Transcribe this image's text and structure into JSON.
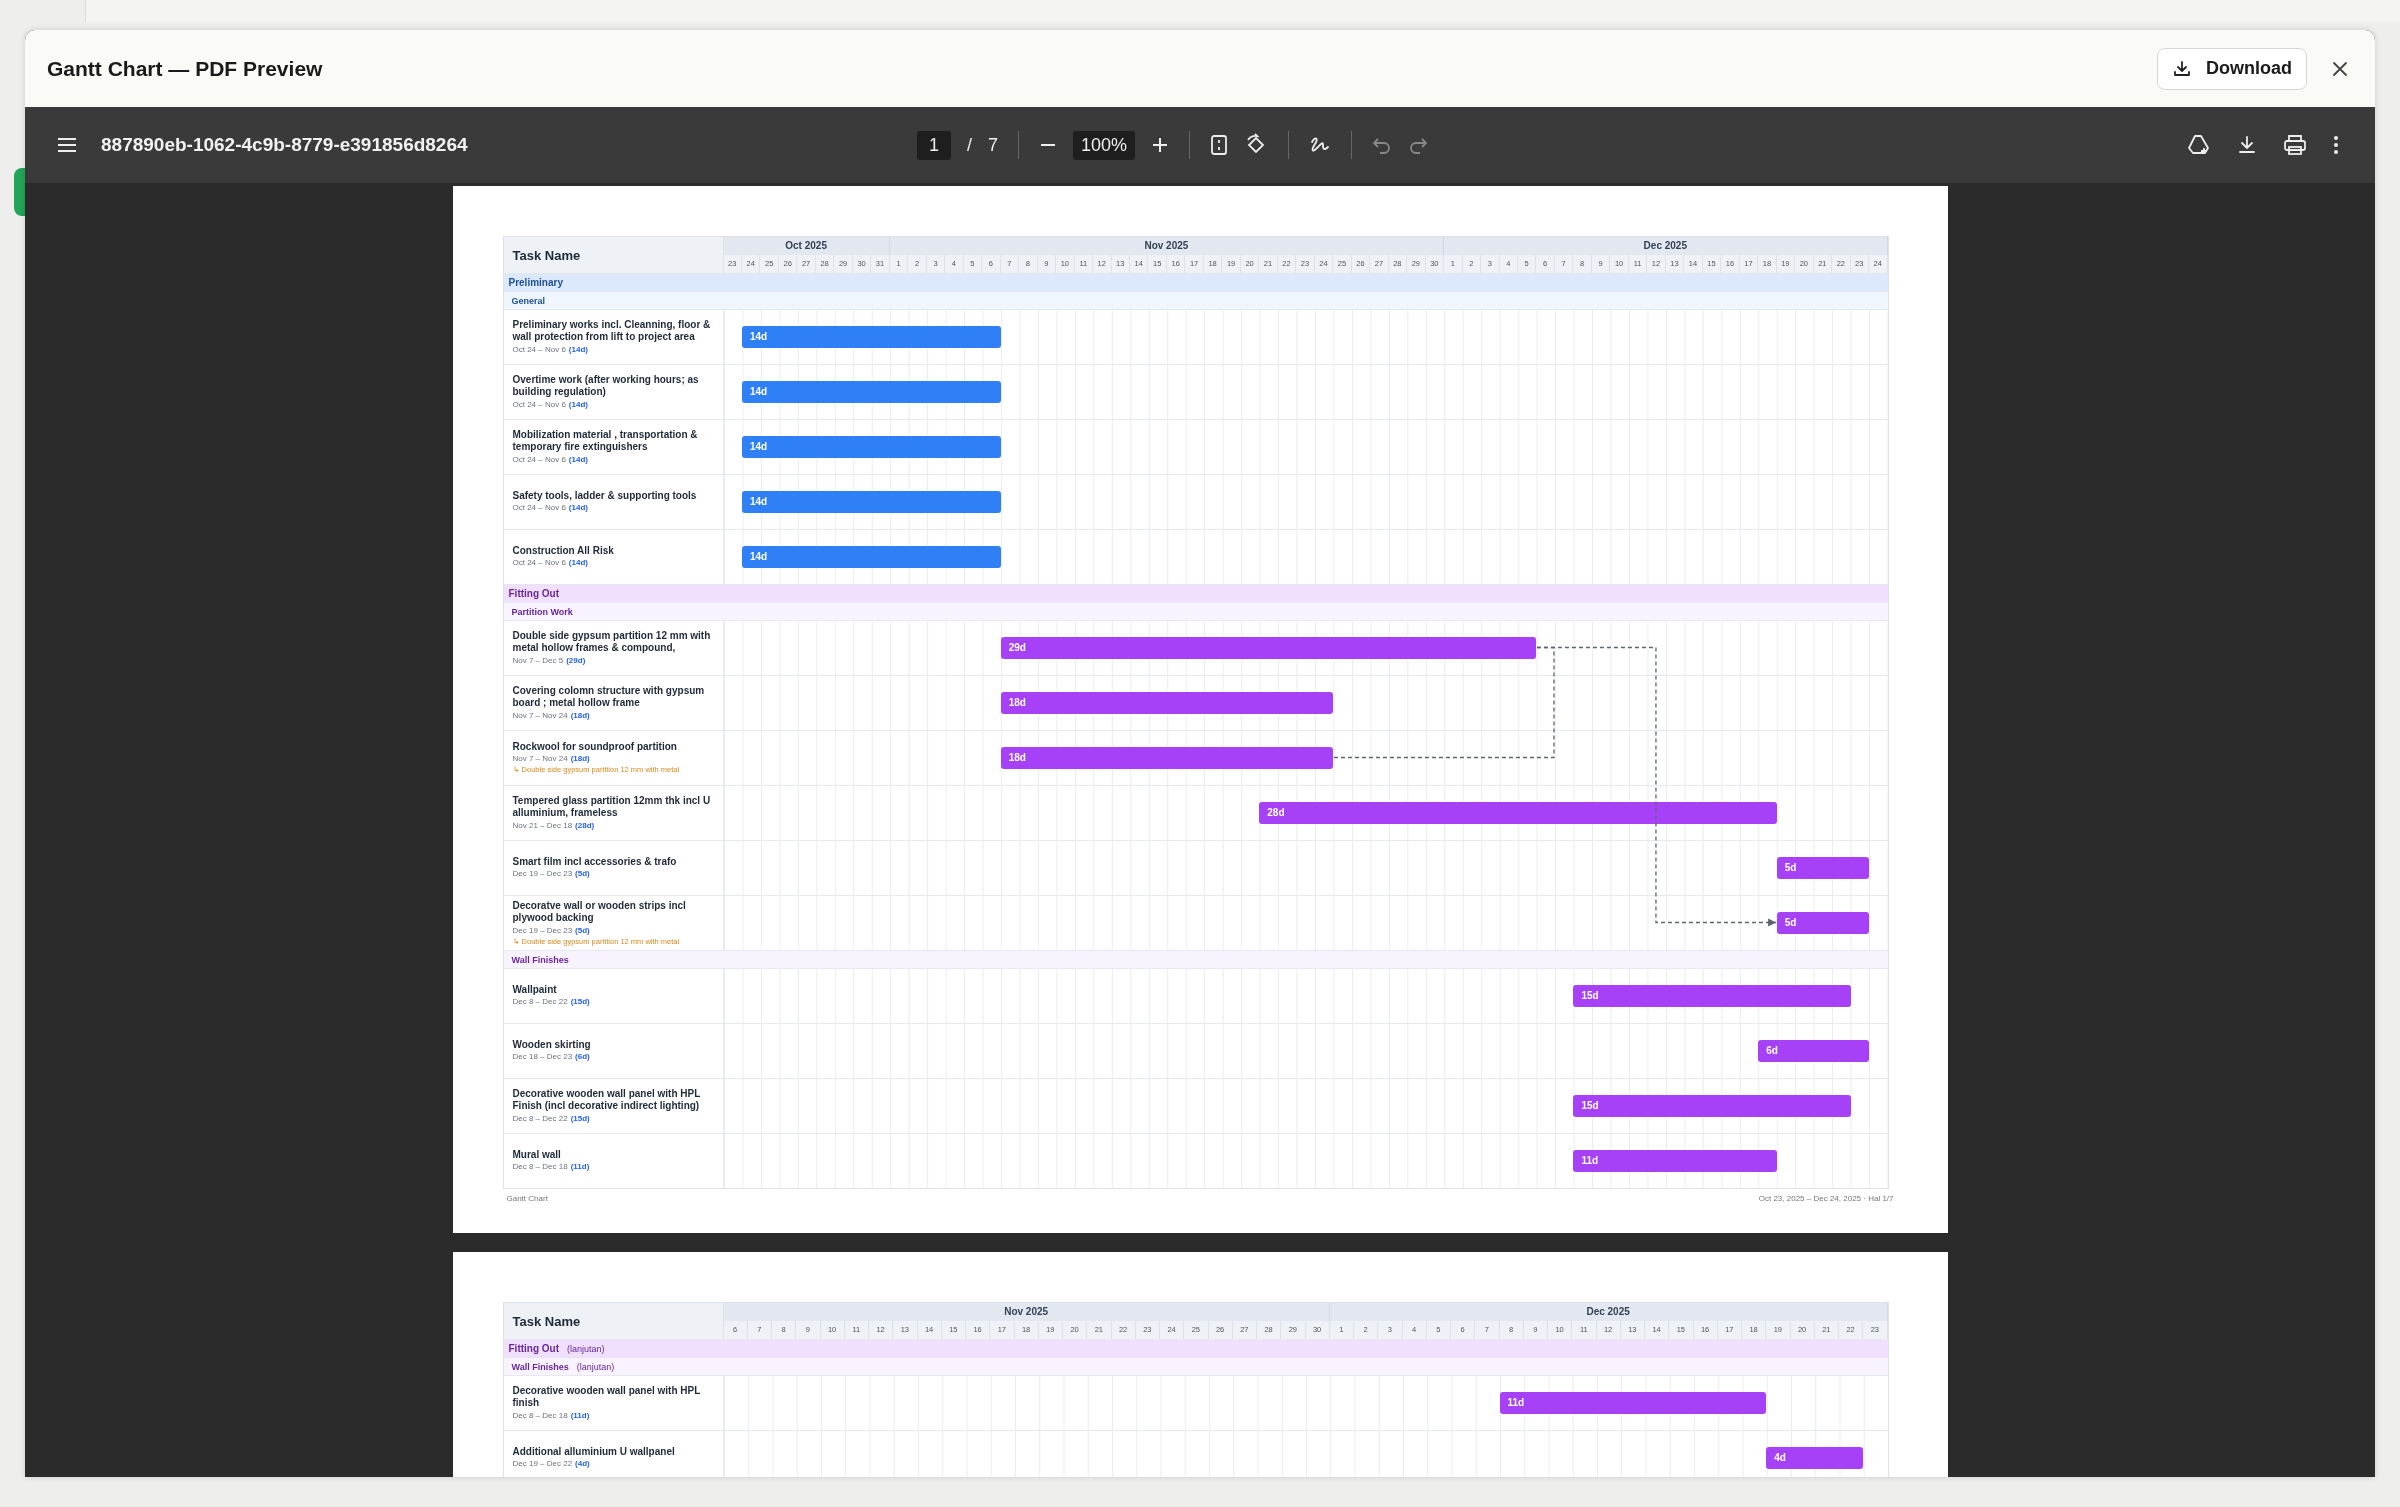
{
  "dialog": {
    "title": "Gantt Chart — PDF Preview",
    "download_label": "Download"
  },
  "viewer": {
    "file_name": "887890eb-1062-4c9b-8779-e391856d8264",
    "page_current": "1",
    "page_separator": "/",
    "page_total": "7",
    "zoom": "100%"
  },
  "pages": [
    {
      "task_header": "Task Name",
      "months": [
        {
          "label": "Oct 2025",
          "days": [
            "23",
            "24",
            "25",
            "26",
            "27",
            "28",
            "29",
            "30",
            "31"
          ]
        },
        {
          "label": "Nov 2025",
          "days": [
            "1",
            "2",
            "3",
            "4",
            "5",
            "6",
            "7",
            "8",
            "9",
            "10",
            "11",
            "12",
            "13",
            "14",
            "15",
            "16",
            "17",
            "18",
            "19",
            "20",
            "21",
            "22",
            "23",
            "24",
            "25",
            "26",
            "27",
            "28",
            "29",
            "30"
          ]
        },
        {
          "label": "Dec 2025",
          "days": [
            "1",
            "2",
            "3",
            "4",
            "5",
            "6",
            "7",
            "8",
            "9",
            "10",
            "11",
            "12",
            "13",
            "14",
            "15",
            "16",
            "17",
            "18",
            "19",
            "20",
            "21",
            "22",
            "23",
            "24"
          ]
        }
      ],
      "groups": [
        {
          "name": "Preliminary",
          "color": "#2f80f6",
          "subgroups": [
            {
              "name": "General",
              "tasks": [
                {
                  "name": "Preliminary works incl. Cleanning, floor & wall protection from lift to project area",
                  "dates": "Oct 24 – Nov 6",
                  "duration": "(14d)",
                  "bar": {
                    "label": "14d"
                  }
                },
                {
                  "name": "Overtime work (after working hours; as building regulation)",
                  "dates": "Oct 24 – Nov 6",
                  "duration": "(14d)",
                  "bar": {
                    "label": "14d"
                  }
                },
                {
                  "name": "Mobilization material , transportation & temporary fire extinguishers",
                  "dates": "Oct 24 – Nov 6",
                  "duration": "(14d)",
                  "bar": {
                    "label": "14d"
                  }
                },
                {
                  "name": "Safety tools, ladder & supporting tools",
                  "dates": "Oct 24 – Nov 6",
                  "duration": "(14d)",
                  "bar": {
                    "label": "14d"
                  }
                },
                {
                  "name": "Construction All Risk",
                  "dates": "Oct 24 – Nov 6",
                  "duration": "(14d)",
                  "bar": {
                    "label": "14d"
                  }
                }
              ]
            }
          ]
        },
        {
          "name": "Fitting Out",
          "color": "#a641f8",
          "subgroups": [
            {
              "name": "Partition Work",
              "tasks": [
                {
                  "name": "Double side gypsum partition 12 mm with metal hollow frames & compound,",
                  "dates": "Nov 7 – Dec 5",
                  "duration": "(29d)",
                  "bar": {
                    "label": "29d"
                  }
                },
                {
                  "name": "Covering colomn structure with gypsum board ; metal hollow frame",
                  "dates": "Nov 7 – Nov 24",
                  "duration": "(18d)",
                  "bar": {
                    "label": "18d"
                  }
                },
                {
                  "name": "Rockwool for soundproof partition",
                  "dates": "Nov 7 – Nov 24",
                  "duration": "(18d)",
                  "depends_on": "↳ Double side gypsum partition 12 mm with metal",
                  "bar": {
                    "label": "18d"
                  }
                },
                {
                  "name": "Tempered glass partition 12mm thk incl U alluminium, frameless",
                  "dates": "Nov 21 – Dec 18",
                  "duration": "(28d)",
                  "bar": {
                    "label": "28d"
                  }
                },
                {
                  "name": "Smart film incl accessories & trafo",
                  "dates": "Dec 19 – Dec 23",
                  "duration": "(5d)",
                  "bar": {
                    "label": "5d"
                  }
                },
                {
                  "name": "Decoratve wall or wooden strips incl plywood backing",
                  "dates": "Dec 19 – Dec 23",
                  "duration": "(5d)",
                  "depends_on": "↳ Double side gypsum partition 12 mm with metal",
                  "bar": {
                    "label": "5d"
                  }
                }
              ]
            },
            {
              "name": "Wall Finishes",
              "tasks": [
                {
                  "name": "Wallpaint",
                  "dates": "Dec 8 – Dec 22",
                  "duration": "(15d)",
                  "bar": {
                    "label": "15d"
                  }
                },
                {
                  "name": "Wooden skirting",
                  "dates": "Dec 18 – Dec 23",
                  "duration": "(6d)",
                  "bar": {
                    "label": "6d"
                  }
                },
                {
                  "name": "Decorative wooden wall panel with HPL Finish (incl decorative indirect lighting)",
                  "dates": "Dec 8 – Dec 22",
                  "duration": "(15d)",
                  "bar": {
                    "label": "15d"
                  }
                },
                {
                  "name": "Mural wall",
                  "dates": "Dec 8 – Dec 18",
                  "duration": "(11d)",
                  "bar": {
                    "label": "11d"
                  }
                }
              ]
            }
          ]
        }
      ],
      "footer_left": "Gantt Chart",
      "footer_right": "Oct 23, 2025 – Dec 24, 2025 · Hal 1/7"
    },
    {
      "task_header": "Task Name",
      "months": [
        {
          "label": "Nov 2025",
          "days": [
            "6",
            "7",
            "8",
            "9",
            "10",
            "11",
            "12",
            "13",
            "14",
            "15",
            "16",
            "17",
            "18",
            "19",
            "20",
            "21",
            "22",
            "23",
            "24",
            "25",
            "26",
            "27",
            "28",
            "29",
            "30"
          ]
        },
        {
          "label": "Dec 2025",
          "days": [
            "1",
            "2",
            "3",
            "4",
            "5",
            "6",
            "7",
            "8",
            "9",
            "10",
            "11",
            "12",
            "13",
            "14",
            "15",
            "16",
            "17",
            "18",
            "19",
            "20",
            "21",
            "22",
            "23"
          ]
        }
      ],
      "groups": [
        {
          "name": "Fitting Out",
          "note": "(lanjutan)",
          "color": "#a641f8",
          "subgroups": [
            {
              "name": "Wall Finishes",
              "note": "(lanjutan)",
              "tasks": [
                {
                  "name": "Decorative wooden wall panel with HPL finish",
                  "dates": "Dec 8 – Dec 18",
                  "duration": "(11d)",
                  "bar": {
                    "label": "11d"
                  }
                },
                {
                  "name": "Additional alluminium U wallpanel",
                  "dates": "Dec 19 – Dec 22",
                  "duration": "(4d)",
                  "bar": {
                    "label": "4d"
                  }
                }
              ]
            }
          ]
        }
      ]
    }
  ]
}
